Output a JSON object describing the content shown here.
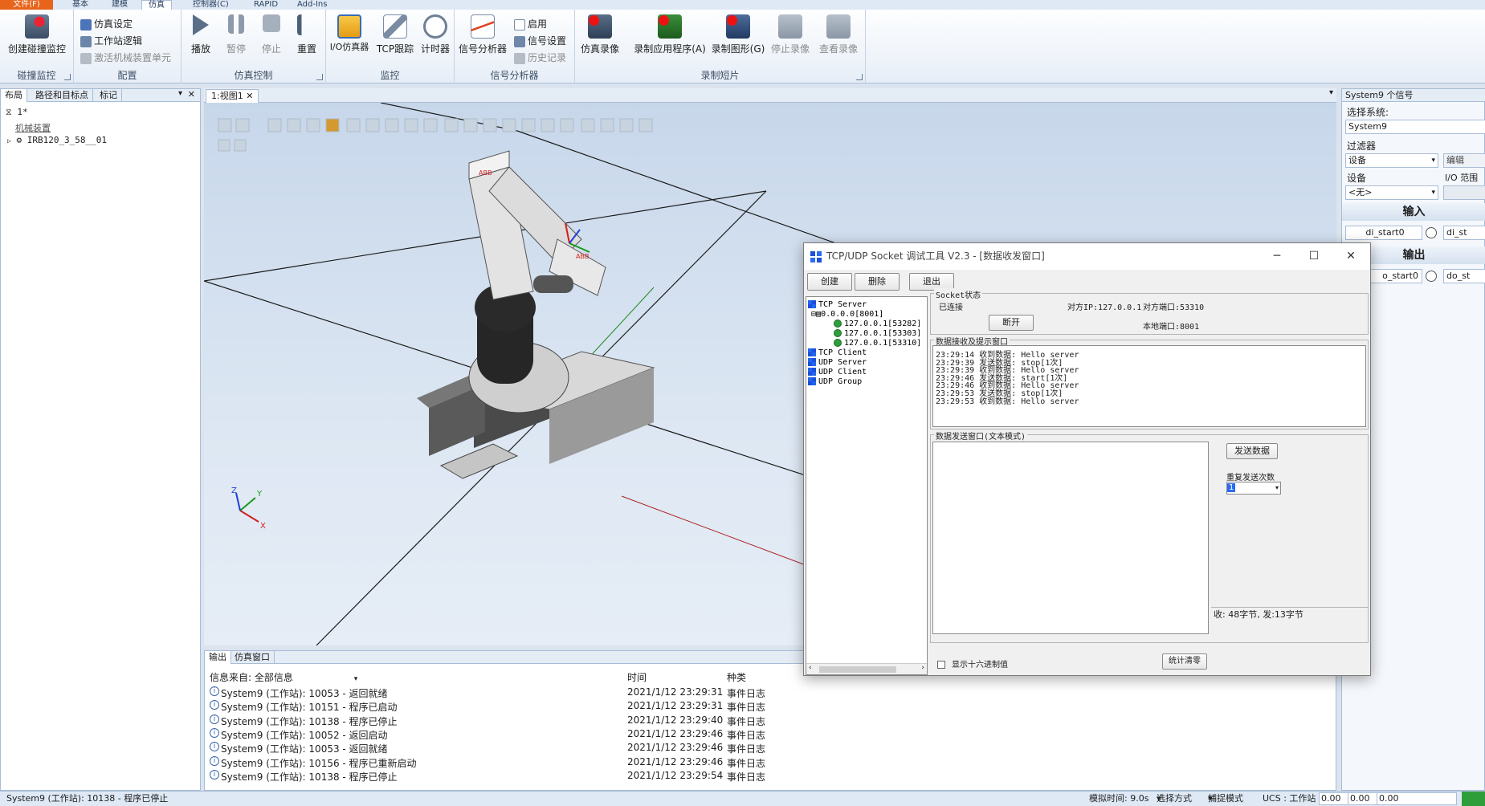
{
  "ribbon": {
    "tabs": [
      "文件(F)",
      "基本",
      "建模",
      "仿真",
      "控制器(C)",
      "RAPID",
      "Add-Ins"
    ],
    "groups": {
      "collision": "碰撞监控",
      "config": "配置",
      "simcontrol": "仿真控制",
      "monitor": "监控",
      "signal": "信号分析器",
      "record": "录制短片"
    },
    "buttons": {
      "create_collision": "创建碰撞监控",
      "sim_setup": "仿真设定",
      "station_logic": "工作站逻辑",
      "activate_mech": "激活机械装置单元",
      "play": "播放",
      "pause": "暂停",
      "stop": "停止",
      "reset": "重置",
      "io_sim": "I/O仿真器",
      "tcp_trace": "TCP跟踪",
      "timer": "计时器",
      "signal_analyzer": "信号分析器",
      "enable": "启用",
      "signal_setup": "信号设置",
      "history": "历史记录",
      "sim_record": "仿真录像",
      "record_app": "录制应用程序(A)",
      "record_graphics": "录制图形(G)",
      "stop_record": "停止录像",
      "view_record": "查看录像"
    }
  },
  "left_panel": {
    "tabs": [
      "布局",
      "路径和目标点",
      "标记"
    ],
    "station": "1*",
    "section": "机械装置",
    "robot": "IRB120_3_58__01"
  },
  "viewport": {
    "tab": "1:视图1",
    "axes": {
      "x": "X",
      "y": "Y",
      "z": "Z"
    }
  },
  "output": {
    "tabs": [
      "输出",
      "仿真窗口"
    ],
    "filter_label": "信息来自: 全部信息",
    "col_time": "时间",
    "col_type": "种类",
    "rows": [
      {
        "msg": "System9 (工作站): 10053 - 返回就绪",
        "time": "2021/1/12 23:29:31",
        "type": "事件日志"
      },
      {
        "msg": "System9 (工作站): 10151 - 程序已启动",
        "time": "2021/1/12 23:29:31",
        "type": "事件日志"
      },
      {
        "msg": "System9 (工作站): 10138 - 程序已停止",
        "time": "2021/1/12 23:29:40",
        "type": "事件日志"
      },
      {
        "msg": "System9 (工作站): 10052 - 返回启动",
        "time": "2021/1/12 23:29:46",
        "type": "事件日志"
      },
      {
        "msg": "System9 (工作站): 10053 - 返回就绪",
        "time": "2021/1/12 23:29:46",
        "type": "事件日志"
      },
      {
        "msg": "System9 (工作站): 10156 - 程序已重新启动",
        "time": "2021/1/12 23:29:46",
        "type": "事件日志"
      },
      {
        "msg": "System9 (工作站): 10138 - 程序已停止",
        "time": "2021/1/12 23:29:54",
        "type": "事件日志"
      }
    ]
  },
  "signals_panel": {
    "title": "System9 个信号",
    "select_system_label": "选择系统:",
    "system": "System9",
    "filter_label": "过滤器",
    "filter_value": "设备",
    "edit_label": "编辑",
    "device_label": "设备",
    "io_range": "I/O 范围",
    "device_value": "<无>",
    "input_band": "输入",
    "output_band": "输出",
    "inputs": [
      "di_start0",
      "di_st"
    ],
    "outputs": [
      "o_start0",
      "do_st"
    ]
  },
  "status_bar": {
    "left": "System9 (工作站): 10138 - 程序已停止",
    "sim_time": "模拟时间: 9.0s",
    "select_mode": "选择方式",
    "snap_mode": "捕捉模式",
    "ucs": "UCS : 工作站",
    "coords": [
      "0.00",
      "0.00",
      "0.00"
    ]
  },
  "dialog": {
    "title": "TCP/UDP Socket 调试工具 V2.3 - [数据收发窗口]",
    "btn_create": "创建",
    "btn_delete": "删除",
    "btn_exit": "退出",
    "tree": {
      "tcp_server": "TCP Server",
      "listener": "0.0.0.0[8001]",
      "clients": [
        "127.0.0.1[53282]",
        "127.0.0.1[53303]",
        "127.0.0.1[53310]"
      ],
      "tcp_client": "TCP Client",
      "udp_server": "UDP Server",
      "udp_client": "UDP Client",
      "udp_group": "UDP Group"
    },
    "socket_state_legend": "Socket状态",
    "connected": "已连接",
    "peer_ip": "对方IP:127.0.0.1",
    "peer_port": "对方端口:53310",
    "local_port": "本地端口:8001",
    "btn_disconnect": "断开",
    "recv_legend": "数据接收及提示窗口",
    "recv_lines": [
      "23:29:14 收到数据: Hello server",
      "23:29:39 发送数据: stop[1次]",
      "23:29:39 收到数据: Hello server",
      "23:29:46 发送数据: start[1次]",
      "23:29:46 收到数据: Hello server",
      "23:29:53 发送数据: stop[1次]",
      "23:29:53 收到数据: Hello server"
    ],
    "send_legend": "数据发送窗口(文本模式)",
    "btn_send": "发送数据",
    "repeat_label": "重复发送次数",
    "repeat_value": "1",
    "stats": "收: 48字节, 发:13字节",
    "hex_label": "显示十六进制值",
    "btn_clear_stats": "统计清零"
  },
  "colors": {
    "file_tab": "#e8641b",
    "viewport_bg": "#c7d7ea",
    "accent_blue": "#1d4fd8",
    "robot_body": "#d9d9d9",
    "abb_red": "#d11f1f"
  }
}
